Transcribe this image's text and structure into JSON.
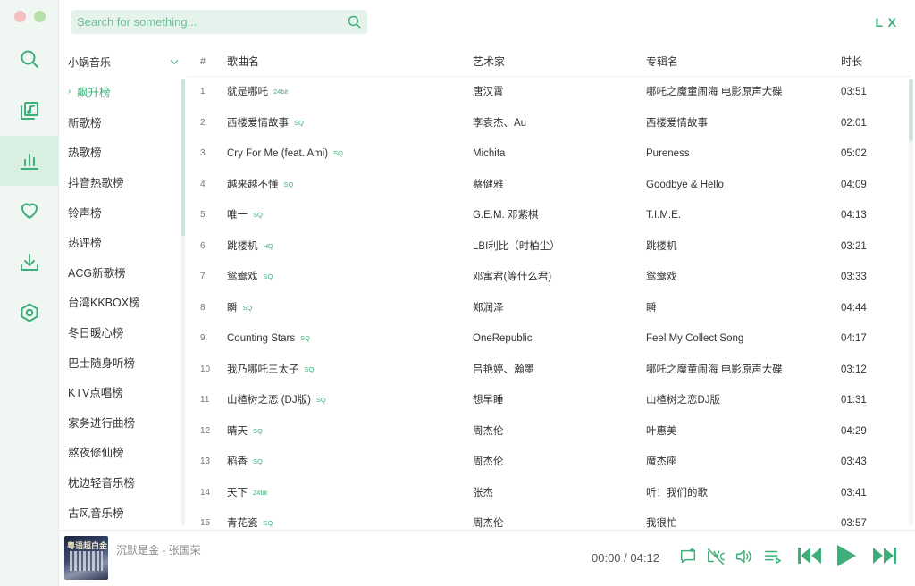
{
  "search": {
    "placeholder": "Search for something..."
  },
  "brand": "L X",
  "source_select": {
    "value": "小蜗音乐"
  },
  "rank_lists": [
    "飙升榜",
    "新歌榜",
    "热歌榜",
    "抖音热歌榜",
    "铃声榜",
    "热评榜",
    "ACG新歌榜",
    "台湾KKBOX榜",
    "冬日暖心榜",
    "巴士随身听榜",
    "KTV点唱榜",
    "家务进行曲榜",
    "熬夜修仙榜",
    "枕边轻音乐榜",
    "古风音乐榜"
  ],
  "active_rank": "飙升榜",
  "table": {
    "headers": {
      "num": "#",
      "name": "歌曲名",
      "artist": "艺术家",
      "album": "专辑名",
      "time": "时长"
    },
    "rows": [
      {
        "num": "1",
        "name": "就是哪吒",
        "tag": "24bit",
        "artist": "唐汉霄",
        "album": "哪吒之魔童闹海 电影原声大碟",
        "time": "03:51"
      },
      {
        "num": "2",
        "name": "西楼爱情故事",
        "tag": "SQ",
        "artist": "李袁杰、Au",
        "album": "西楼爱情故事",
        "time": "02:01"
      },
      {
        "num": "3",
        "name": "Cry For Me (feat. Ami)",
        "tag": "SQ",
        "artist": "Michita",
        "album": "Pureness",
        "time": "05:02"
      },
      {
        "num": "4",
        "name": "越来越不懂",
        "tag": "SQ",
        "artist": "蔡健雅",
        "album": "Goodbye & Hello",
        "time": "04:09"
      },
      {
        "num": "5",
        "name": "唯一",
        "tag": "SQ",
        "artist": "G.E.M. 邓紫棋",
        "album": "T.I.M.E.",
        "time": "04:13"
      },
      {
        "num": "6",
        "name": "跳楼机",
        "tag": "HQ",
        "artist": "LBI利比（时柏尘）",
        "album": "跳楼机",
        "time": "03:21"
      },
      {
        "num": "7",
        "name": "鸳鸯戏",
        "tag": "SQ",
        "artist": "邓寓君(等什么君)",
        "album": "鸳鸯戏",
        "time": "03:33"
      },
      {
        "num": "8",
        "name": "瞬",
        "tag": "SQ",
        "artist": "郑润泽",
        "album": "瞬",
        "time": "04:44"
      },
      {
        "num": "9",
        "name": "Counting Stars",
        "tag": "SQ",
        "artist": "OneRepublic",
        "album": "Feel My Collect Song",
        "time": "04:17"
      },
      {
        "num": "10",
        "name": "我乃哪吒三太子",
        "tag": "SQ",
        "artist": "吕艳婷、瀚墨",
        "album": "哪吒之魔童闹海 电影原声大碟",
        "time": "03:12"
      },
      {
        "num": "11",
        "name": "山楂树之恋 (DJ版)",
        "tag": "SQ",
        "artist": "想早睡",
        "album": "山楂树之恋DJ版",
        "time": "01:31"
      },
      {
        "num": "12",
        "name": "晴天",
        "tag": "SQ",
        "artist": "周杰伦",
        "album": "叶惠美",
        "time": "04:29"
      },
      {
        "num": "13",
        "name": "稻香",
        "tag": "SQ",
        "artist": "周杰伦",
        "album": "魔杰座",
        "time": "03:43"
      },
      {
        "num": "14",
        "name": "天下",
        "tag": "24bit",
        "artist": "张杰",
        "album": "听！我们的歌",
        "time": "03:41"
      },
      {
        "num": "15",
        "name": "青花瓷",
        "tag": "SQ",
        "artist": "周杰伦",
        "album": "我很忙",
        "time": "03:57"
      }
    ]
  },
  "player": {
    "cover_text": "粤语超白金",
    "now_playing": "沉默是金 - 张国荣",
    "current_time": "00:00",
    "separator": "/",
    "total_time": "04:12"
  },
  "icons": {
    "rail": [
      "search-icon",
      "music-library-icon",
      "leaderboard-icon",
      "heart-icon",
      "download-icon",
      "settings-icon"
    ],
    "player": [
      "comment-icon",
      "lyrics-icon",
      "volume-icon",
      "playlist-icon",
      "previous-icon",
      "play-icon",
      "next-icon"
    ]
  },
  "colors": {
    "accent": "#3fae78",
    "rail_bg": "#f0f7f3",
    "active_bg": "#d9efe2"
  }
}
